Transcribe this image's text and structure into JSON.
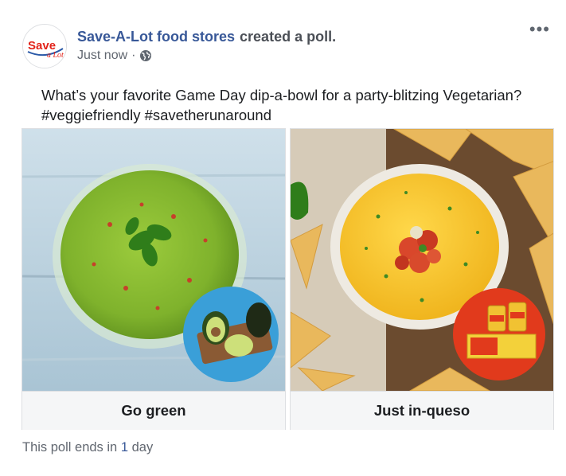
{
  "header": {
    "author": "Save-A-Lot food stores",
    "action": "created a poll.",
    "timestamp": "Just now",
    "separator": "·",
    "privacy_icon": "globe-icon",
    "more_icon": "more-options-icon",
    "more_label": "•••",
    "avatar": {
      "brand_top": "Save",
      "brand_bottom": "a Lot"
    }
  },
  "post": {
    "text": "What’s your favorite Game Day dip-a-bowl for a party-blitzing Vegetarian? #veggiefriendly #savetherunaround"
  },
  "poll": {
    "options": [
      {
        "label": "Go green"
      },
      {
        "label": "Just in-queso"
      }
    ],
    "footer_prefix": "This poll ends in ",
    "footer_number": "1",
    "footer_suffix": " day"
  },
  "colors": {
    "link": "#385898",
    "secondary_text": "#616770",
    "option_bg": "#f5f6f7",
    "border": "#dddfe2",
    "brand_red": "#e2231a"
  }
}
